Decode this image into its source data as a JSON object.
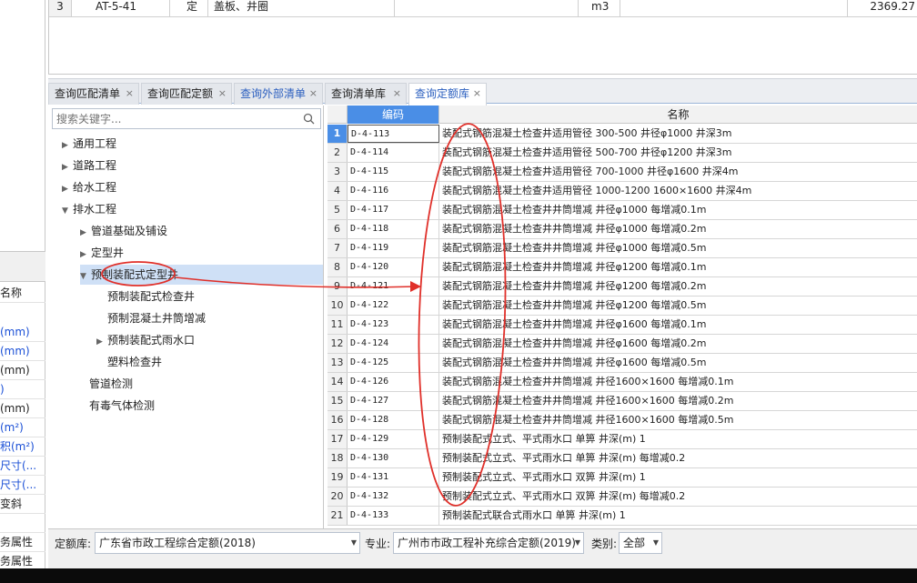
{
  "top_row": {
    "index": "3",
    "code": "AT-5-41",
    "type": "定",
    "name": "盖板、井圈",
    "unit": "m3",
    "amount": "2369.27"
  },
  "left_panel": {
    "header": "名称",
    "rows": [
      "(mm)",
      "(mm)",
      "(mm)",
      ")",
      "(mm)",
      "(m²)",
      "积(m²)",
      "尺寸(...",
      "尺寸(...",
      "变斜",
      "",
      "务属性",
      "务属性"
    ]
  },
  "tabs": [
    {
      "label": "查询匹配清单",
      "close": "×"
    },
    {
      "label": "查询匹配定额",
      "close": "×"
    },
    {
      "label": "查询外部清单",
      "close": "×"
    },
    {
      "label": "查询清单库",
      "close": "×"
    },
    {
      "label": "查询定额库",
      "close": "×"
    }
  ],
  "search": {
    "placeholder": "搜索关键字..."
  },
  "tree": [
    {
      "label": "通用工程"
    },
    {
      "label": "道路工程"
    },
    {
      "label": "给水工程"
    },
    {
      "label": "排水工程"
    },
    {
      "label": "管道基础及铺设"
    },
    {
      "label": "定型井"
    },
    {
      "label": "预制装配式定型井"
    },
    {
      "label": "预制装配式检查井"
    },
    {
      "label": "预制混凝土井筒增减"
    },
    {
      "label": "预制装配式雨水口"
    },
    {
      "label": "塑料检查井"
    },
    {
      "label": "管道检测"
    },
    {
      "label": "有毒气体检测"
    }
  ],
  "grid": {
    "col_code": "编码",
    "col_name": "名称",
    "rows": [
      {
        "no": "1",
        "code": "D-4-113",
        "name": "装配式钢筋混凝土检查井适用管径 300-500 井径φ1000 井深3m"
      },
      {
        "no": "2",
        "code": "D-4-114",
        "name": "装配式钢筋混凝土检查井适用管径 500-700 井径φ1200 井深3m"
      },
      {
        "no": "3",
        "code": "D-4-115",
        "name": "装配式钢筋混凝土检查井适用管径 700-1000 井径φ1600 井深4m"
      },
      {
        "no": "4",
        "code": "D-4-116",
        "name": "装配式钢筋混凝土检查井适用管径 1000-1200 1600×1600 井深4m"
      },
      {
        "no": "5",
        "code": "D-4-117",
        "name": "装配式钢筋混凝土检查井井筒增减 井径φ1000 每增减0.1m"
      },
      {
        "no": "6",
        "code": "D-4-118",
        "name": "装配式钢筋混凝土检查井井筒增减 井径φ1000 每增减0.2m"
      },
      {
        "no": "7",
        "code": "D-4-119",
        "name": "装配式钢筋混凝土检查井井筒增减 井径φ1000 每增减0.5m"
      },
      {
        "no": "8",
        "code": "D-4-120",
        "name": "装配式钢筋混凝土检查井井筒增减 井径φ1200 每增减0.1m"
      },
      {
        "no": "9",
        "code": "D-4-121",
        "name": "装配式钢筋混凝土检查井井筒增减 井径φ1200 每增减0.2m"
      },
      {
        "no": "10",
        "code": "D-4-122",
        "name": "装配式钢筋混凝土检查井井筒增减 井径φ1200 每增减0.5m"
      },
      {
        "no": "11",
        "code": "D-4-123",
        "name": "装配式钢筋混凝土检查井井筒增减 井径φ1600 每增减0.1m"
      },
      {
        "no": "12",
        "code": "D-4-124",
        "name": "装配式钢筋混凝土检查井井筒增减 井径φ1600 每增减0.2m"
      },
      {
        "no": "13",
        "code": "D-4-125",
        "name": "装配式钢筋混凝土检查井井筒增减 井径φ1600 每增减0.5m"
      },
      {
        "no": "14",
        "code": "D-4-126",
        "name": "装配式钢筋混凝土检查井井筒增减 井径1600×1600 每增减0.1m"
      },
      {
        "no": "15",
        "code": "D-4-127",
        "name": "装配式钢筋混凝土检查井井筒增减 井径1600×1600 每增减0.2m"
      },
      {
        "no": "16",
        "code": "D-4-128",
        "name": "装配式钢筋混凝土检查井井筒增减 井径1600×1600 每增减0.5m"
      },
      {
        "no": "17",
        "code": "D-4-129",
        "name": "预制装配式立式、平式雨水口 单箅 井深(m) 1"
      },
      {
        "no": "18",
        "code": "D-4-130",
        "name": "预制装配式立式、平式雨水口 单箅 井深(m) 每增减0.2"
      },
      {
        "no": "19",
        "code": "D-4-131",
        "name": "预制装配式立式、平式雨水口 双箅 井深(m) 1"
      },
      {
        "no": "20",
        "code": "D-4-132",
        "name": "预制装配式立式、平式雨水口 双箅 井深(m) 每增减0.2"
      },
      {
        "no": "21",
        "code": "D-4-133",
        "name": "预制装配式联合式雨水口 单箅 井深(m) 1"
      }
    ]
  },
  "filters": {
    "quota_label": "定额库:",
    "quota_value": "广东省市政工程综合定额(2018)",
    "major_label": "专业:",
    "major_value": "广州市市政工程补充综合定额(2019)",
    "category_label": "类别:",
    "category_value": "全部"
  },
  "colors": {
    "accent": "#4a8ee6",
    "annotation": "#e0302a",
    "selection": "#cfe0f6"
  }
}
